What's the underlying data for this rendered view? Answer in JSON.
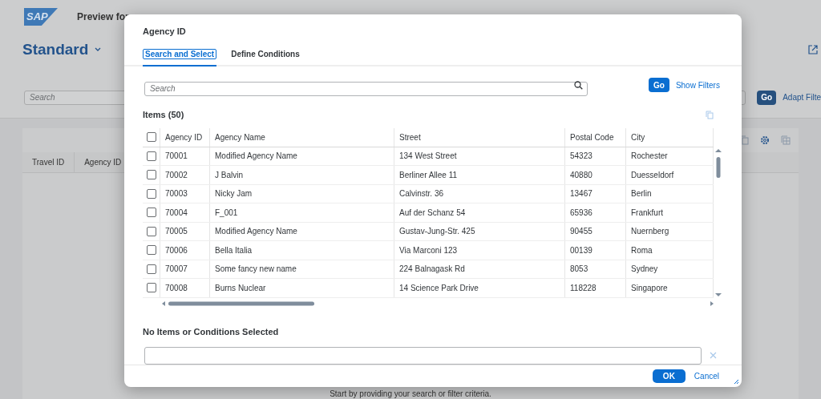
{
  "background": {
    "logo_text": "SAP",
    "app_title": "Preview for",
    "variant": "Standard",
    "search": {
      "placeholder": "Search"
    },
    "go_button": "Go",
    "adapt_filters": "Adapt Filte",
    "table_columns": [
      "Travel ID",
      "Agency ID"
    ],
    "empty_message": "Start by providing your search or filter criteria."
  },
  "dialog": {
    "title": "Agency ID",
    "tabs": [
      {
        "label": "Search and Select",
        "selected": true
      },
      {
        "label": "Define Conditions",
        "selected": false
      }
    ],
    "search": {
      "placeholder": "Search"
    },
    "go_button": "Go",
    "show_filters": "Show Filters",
    "items_title": "Items (50)",
    "table": {
      "select_all": false,
      "columns": [
        "Agency ID",
        "Agency Name",
        "Street",
        "Postal Code",
        "City"
      ],
      "rows": [
        {
          "selected": false,
          "cells": [
            "70001",
            "Modified Agency Name",
            "134 West Street",
            "54323",
            "Rochester"
          ]
        },
        {
          "selected": false,
          "cells": [
            "70002",
            "J Balvin",
            "Berliner Allee 11",
            "40880",
            "Duesseldorf"
          ]
        },
        {
          "selected": false,
          "cells": [
            "70003",
            "Nicky Jam",
            "Calvinstr. 36",
            "13467",
            "Berlin"
          ]
        },
        {
          "selected": false,
          "cells": [
            "70004",
            "F_001",
            "Auf der Schanz 54",
            "65936",
            "Frankfurt"
          ]
        },
        {
          "selected": false,
          "cells": [
            "70005",
            "Modified Agency Name",
            "Gustav-Jung-Str. 425",
            "90455",
            "Nuernberg"
          ]
        },
        {
          "selected": false,
          "cells": [
            "70006",
            "Bella Italia",
            "Via Marconi 123",
            "00139",
            "Roma"
          ]
        },
        {
          "selected": false,
          "cells": [
            "70007",
            "Some fancy new name",
            "224 Balnagask Rd",
            "8053",
            "Sydney"
          ]
        },
        {
          "selected": false,
          "cells": [
            "70008",
            "Burns Nuclear",
            "14 Science Park Drive",
            "118228",
            "Singapore"
          ]
        }
      ]
    },
    "selected_title": "No Items or Conditions Selected",
    "ok_button": "OK",
    "cancel_button": "Cancel"
  }
}
